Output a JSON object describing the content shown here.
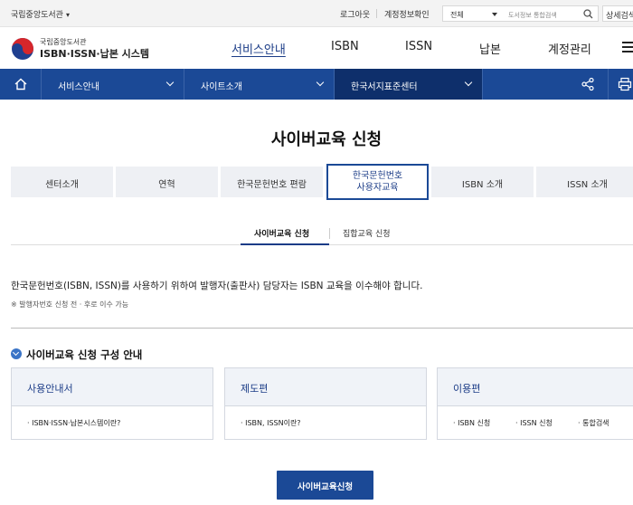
{
  "utility": {
    "library_name": "국립중앙도서관",
    "logout": "로그아웃",
    "account_info": "계정정보확인",
    "search_scope": "전체",
    "search_placeholder": "도서정보 통합검색",
    "advanced_search": "상세검색"
  },
  "header": {
    "logo_small": "국립중앙도서관",
    "logo_big": "ISBN·ISSN·납본 시스템",
    "gnb": [
      "서비스안내",
      "ISBN",
      "ISSN",
      "납본",
      "계정관리"
    ]
  },
  "bluenav": {
    "dropdowns": [
      "서비스안내",
      "사이트소개",
      "한국서지표준센터"
    ]
  },
  "page_title": "사이버교육 신청",
  "tabs": [
    {
      "label": "센터소개"
    },
    {
      "label": "연혁"
    },
    {
      "label": "한국문헌번호 편람"
    },
    {
      "line1": "한국문헌번호",
      "line2": "사용자교육"
    },
    {
      "label": "ISBN 소개"
    },
    {
      "label": "ISSN 소개"
    }
  ],
  "subtabs": [
    "사이버교육 신청",
    "집합교육 신청"
  ],
  "description": "한국문헌번호(ISBN, ISSN)를 사용하기 위하여 발행자(출판사) 담당자는 ISBN 교육을 이수해야 합니다.",
  "note": "※ 발행자번호 신청 전 · 후로 이수 가능",
  "section_title": "사이버교육 신청 구성 안내",
  "cards": [
    {
      "title": "사용안내서",
      "items": [
        "ISBN·ISSN·납본시스템이란?"
      ]
    },
    {
      "title": "제도편",
      "items": [
        "ISBN, ISSN이란?"
      ]
    },
    {
      "title": "이용편",
      "items": [
        "ISBN 신청",
        "ISSN 신청",
        "통합검색"
      ]
    }
  ],
  "apply_button": "사이버교육신청",
  "icons": [
    "home-icon",
    "chevron-down-icon",
    "share-icon",
    "print-icon",
    "search-icon",
    "menu-icon",
    "check-circle-icon"
  ],
  "colors": {
    "primary": "#1b4996",
    "dark": "#0e2f6b",
    "accent_text": "#1b3c87"
  }
}
